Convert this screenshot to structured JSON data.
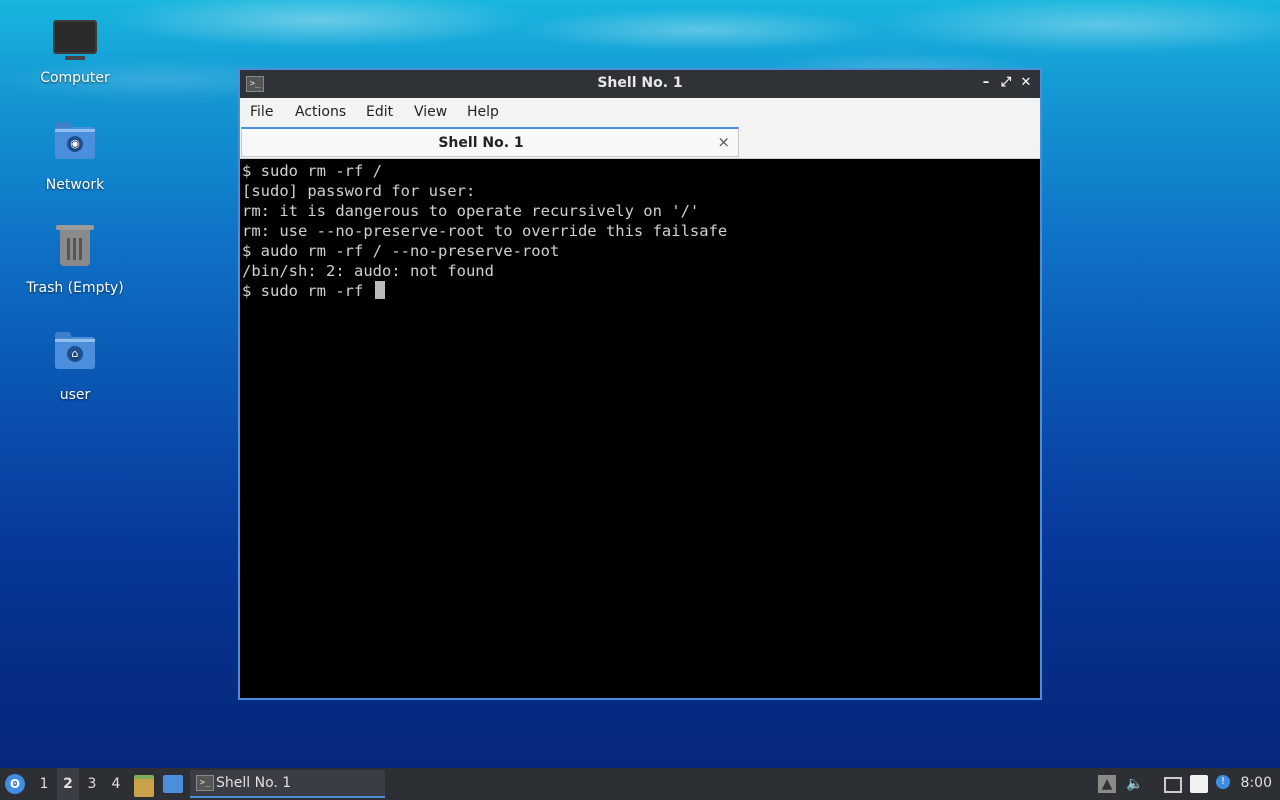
{
  "desktop": {
    "icons": [
      {
        "label": "Computer",
        "icon": "computer-icon"
      },
      {
        "label": "Network",
        "icon": "network-folder-icon"
      },
      {
        "label": "Trash (Empty)",
        "icon": "trash-icon"
      },
      {
        "label": "user",
        "icon": "home-folder-icon"
      }
    ]
  },
  "window": {
    "title": "Shell No. 1",
    "controls": {
      "minimize": "–",
      "maximize": "⤢",
      "close": "✕"
    },
    "menu": [
      "File",
      "Actions",
      "Edit",
      "View",
      "Help"
    ],
    "tab": {
      "label": "Shell No. 1",
      "close": "×"
    },
    "terminal_lines": [
      "$ sudo rm -rf /",
      "[sudo] password for user:",
      "rm: it is dangerous to operate recursively on '/'",
      "rm: use --no-preserve-root to override this failsafe",
      "$ audo rm -rf / --no-preserve-root",
      "/bin/sh: 2: audo: not found",
      "$ sudo rm -rf "
    ]
  },
  "taskbar": {
    "workspaces": [
      "1",
      "2",
      "3",
      "4"
    ],
    "active_workspace": "2",
    "task_label": "Shell No. 1",
    "clock": "8:00"
  },
  "colors": {
    "accent": "#4c8ed8",
    "titlebar": "#2f3236",
    "terminal_bg": "#000000",
    "terminal_fg": "#d0d0d0",
    "taskbar": "#2c2f33"
  }
}
